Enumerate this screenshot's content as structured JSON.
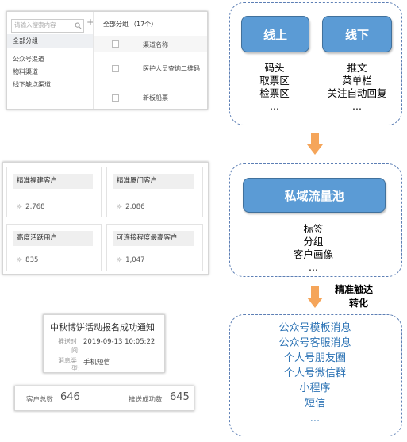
{
  "channel_screenshot": {
    "search_placeholder": "请输入搜索内容",
    "search_icon": "magnifier",
    "add_icon": "+",
    "all_groups": "全部分组",
    "groups": [
      "公众号渠道",
      "物料渠道",
      "线下触点渠道"
    ],
    "header_title": "全部分组",
    "header_count": "（17个）",
    "column_name": "渠道名称",
    "rows": [
      "医护人员查询二维码",
      "新板船票"
    ]
  },
  "online_offline_box": {
    "online_label": "线上",
    "offline_label": "线下",
    "online_items": [
      "码头",
      "取票区",
      "检票区",
      "..."
    ],
    "offline_items": [
      "推文",
      "菜单栏",
      "关注自动回复",
      "..."
    ]
  },
  "customer_cards": {
    "card1": {
      "title": "精准福建客户",
      "value": "2,768"
    },
    "card2": {
      "title": "精准厦门客户",
      "value": "2,086"
    },
    "card3": {
      "title": "高度活跃用户",
      "value": "835"
    },
    "card4": {
      "title": "可连接程度最高客户",
      "value": "1,047"
    }
  },
  "pool_box": {
    "title": "私域流量池",
    "items": [
      "标签",
      "分组",
      "客户画像",
      "..."
    ]
  },
  "arrow_label": {
    "line1": "精准触达",
    "line2": "转化"
  },
  "notification": {
    "title": "中秋博饼活动报名成功通知",
    "push_time_label_1": "推送时",
    "push_time_label_2": "间:",
    "push_time_value": "2019-09-13 10:05:22",
    "msg_type_label_1": "消息类",
    "msg_type_label_2": "型:",
    "msg_type_value": "手机短信"
  },
  "stats": {
    "total_label": "客户总数",
    "total_value": "646",
    "success_label": "推送成功数",
    "success_value": "645"
  },
  "channels_box": {
    "items": [
      "公众号模板消息",
      "公众号客服消息",
      "个人号朋友圈",
      "个人号微信群",
      "小程序",
      "短信",
      "..."
    ]
  },
  "colors": {
    "blue_button": "#5b9bd5",
    "arrow": "#f5a55a",
    "channel_text": "#2e74b5",
    "dashed_border": "#5d7fb5"
  }
}
